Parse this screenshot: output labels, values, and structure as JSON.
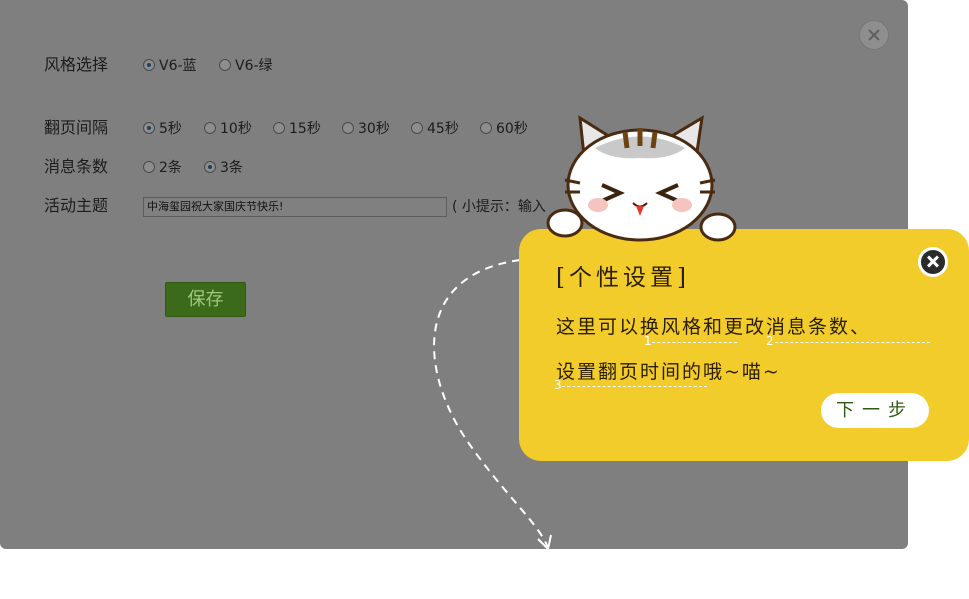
{
  "settings": {
    "style": {
      "label": "风格选择",
      "options": [
        {
          "label": "V6-蓝",
          "selected": true
        },
        {
          "label": "V6-绿",
          "selected": false
        }
      ]
    },
    "interval": {
      "label": "翻页间隔",
      "options": [
        {
          "label": "5秒",
          "selected": true
        },
        {
          "label": "10秒",
          "selected": false
        },
        {
          "label": "15秒",
          "selected": false
        },
        {
          "label": "30秒",
          "selected": false
        },
        {
          "label": "45秒",
          "selected": false
        },
        {
          "label": "60秒",
          "selected": false
        }
      ]
    },
    "count": {
      "label": "消息条数",
      "options": [
        {
          "label": "2条",
          "selected": false
        },
        {
          "label": "3条",
          "selected": true
        }
      ]
    },
    "theme": {
      "label": "活动主题",
      "value": "中海玺园祝大家国庆节快乐!",
      "hint": "( 小提示：输入"
    },
    "save_label": "保存"
  },
  "tip": {
    "title": "[个性设置]",
    "line1": "这里可以换风格和更改消息条数、",
    "line2": "设置翻页时间的哦~喵~",
    "markers": [
      "1",
      "2",
      "3"
    ],
    "next_label": "下一步"
  },
  "colors": {
    "overlay": "#7f7f7f",
    "bubble": "#f2cc2a",
    "save": "#3b6a1a"
  },
  "icons": {
    "panel_close": "close-icon",
    "tip_close": "close-icon"
  }
}
